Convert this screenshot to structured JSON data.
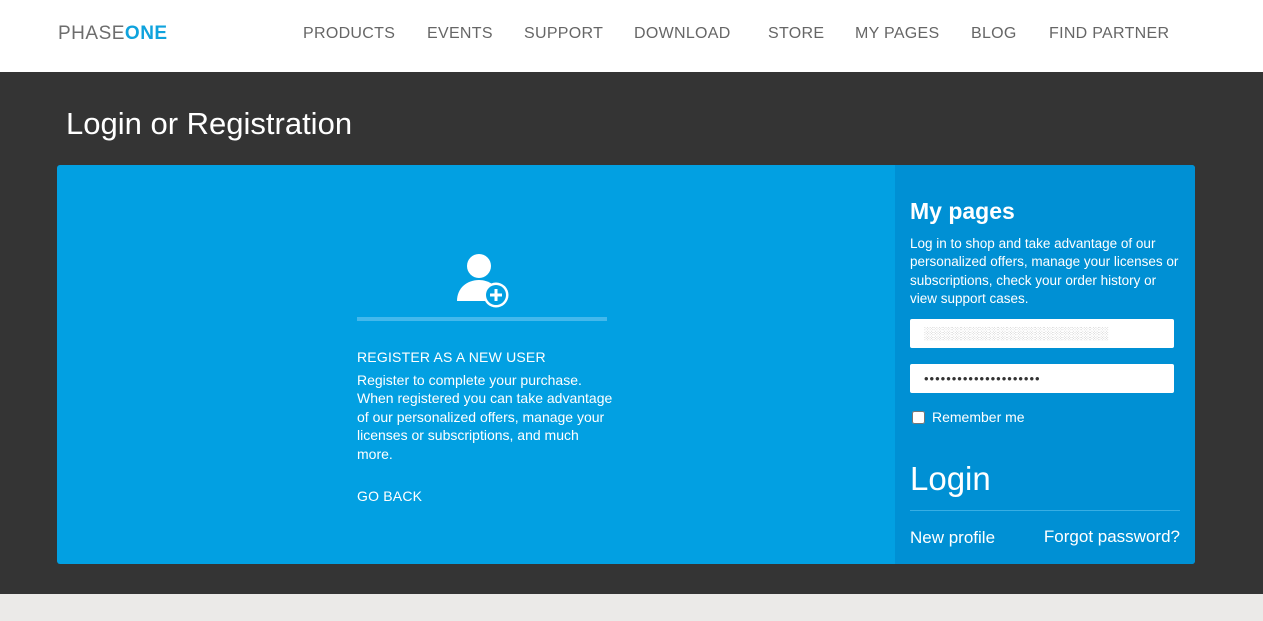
{
  "header": {
    "logo_light": "PHASE",
    "logo_bold": "ONE",
    "nav": [
      "PRODUCTS",
      "EVENTS",
      "SUPPORT",
      "DOWNLOAD",
      "STORE",
      "MY PAGES",
      "BLOG",
      "FIND PARTNER"
    ]
  },
  "page": {
    "title": "Login or Registration"
  },
  "register": {
    "icon": "user-add-icon",
    "heading": "REGISTER AS A NEW USER",
    "text": "Register to complete your purchase. When registered you can take advantage of our personalized offers, manage your licenses or subscriptions, and much more.",
    "go_back": "GO BACK"
  },
  "login": {
    "title": "My pages",
    "text": "Log in to shop and take advantage of our personalized offers, manage your licenses or subscriptions, check your order history or view support cases.",
    "email_value": "░░░░░░░░░░░░░░░░░░░░",
    "password_value": "•••••••••••••••••••••",
    "remember_label": "Remember me",
    "button": "Login",
    "new_profile": "New profile",
    "forgot_password": "Forgot password?"
  },
  "colors": {
    "brand": "#0fa3dd",
    "panel": "#02a0e2",
    "side_panel": "#0090d4",
    "dark_band": "#343434"
  }
}
